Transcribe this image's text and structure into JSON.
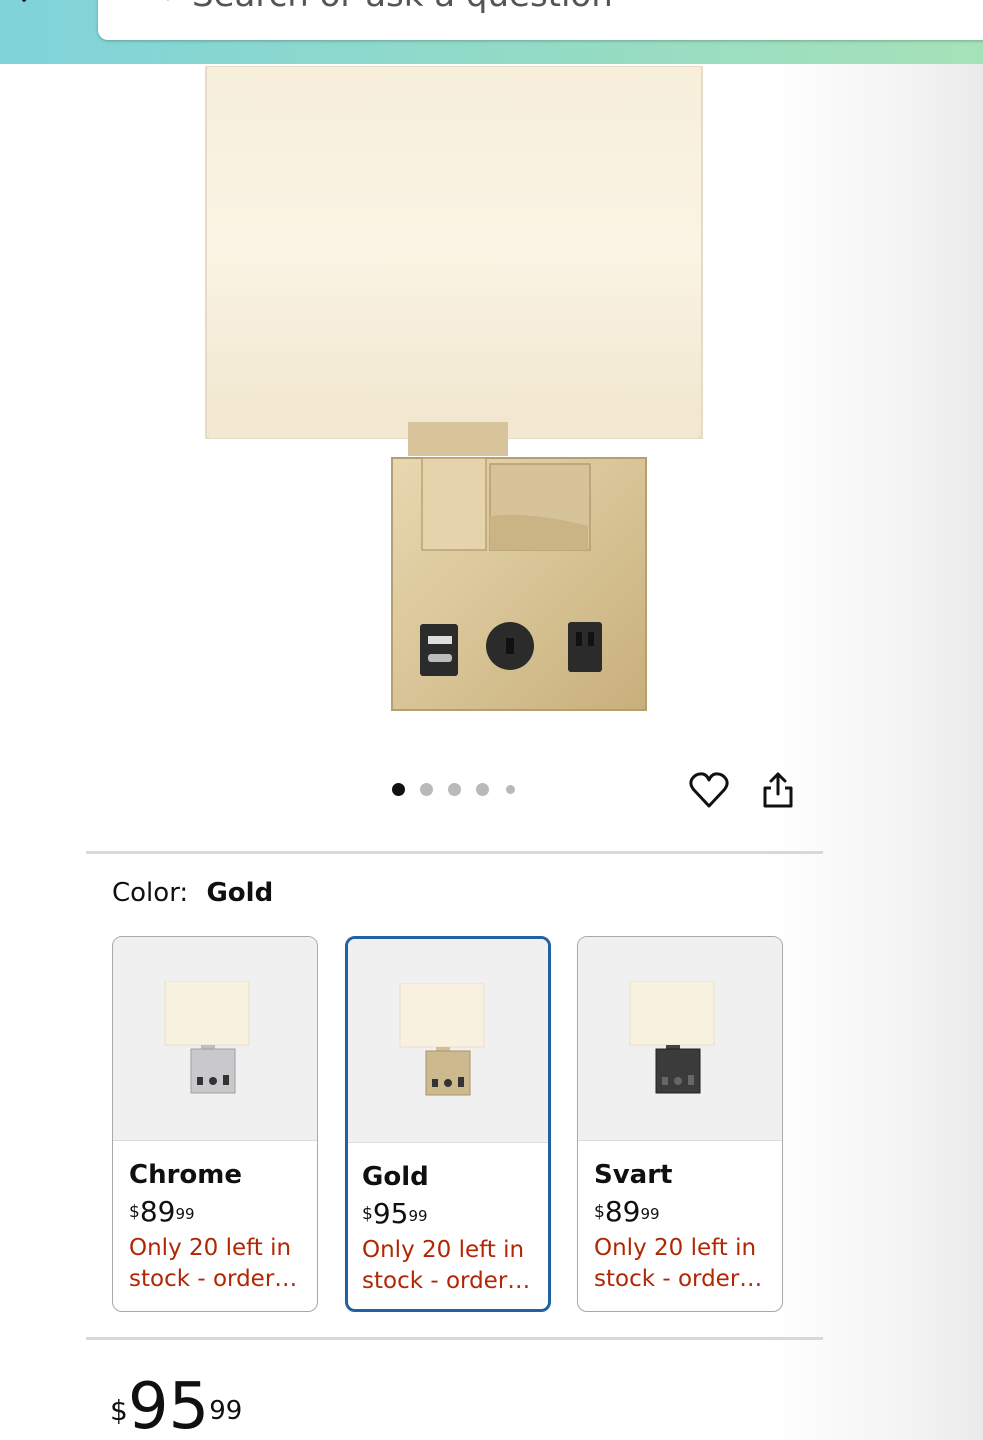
{
  "search": {
    "placeholder": "Search or ask a question"
  },
  "gallery": {
    "dot_count": 5,
    "active_index": 0
  },
  "color_selector": {
    "label": "Color:",
    "selected_value": "Gold"
  },
  "swatches": [
    {
      "name": "Chrome",
      "price_currency": "$",
      "price_whole": "89",
      "price_fraction": "99",
      "stock": "Only 20 left in stock - order…",
      "base_color": "#c9c9cc"
    },
    {
      "name": "Gold",
      "price_currency": "$",
      "price_whole": "95",
      "price_fraction": "99",
      "stock": "Only 20 left in stock - order…",
      "base_color": "#cdb98e"
    },
    {
      "name": "Svart",
      "price_currency": "$",
      "price_whole": "89",
      "price_fraction": "99",
      "stock": "Only 20 left in stock - order…",
      "base_color": "#3b3b3b"
    }
  ],
  "price": {
    "currency": "$",
    "whole": "95",
    "fraction": "99"
  },
  "colors": {
    "accent_selected": "#2162a1",
    "stock_warning": "#b12704",
    "header_gradient_start": "#7fd3d9",
    "header_gradient_end": "#a6e2b9"
  }
}
